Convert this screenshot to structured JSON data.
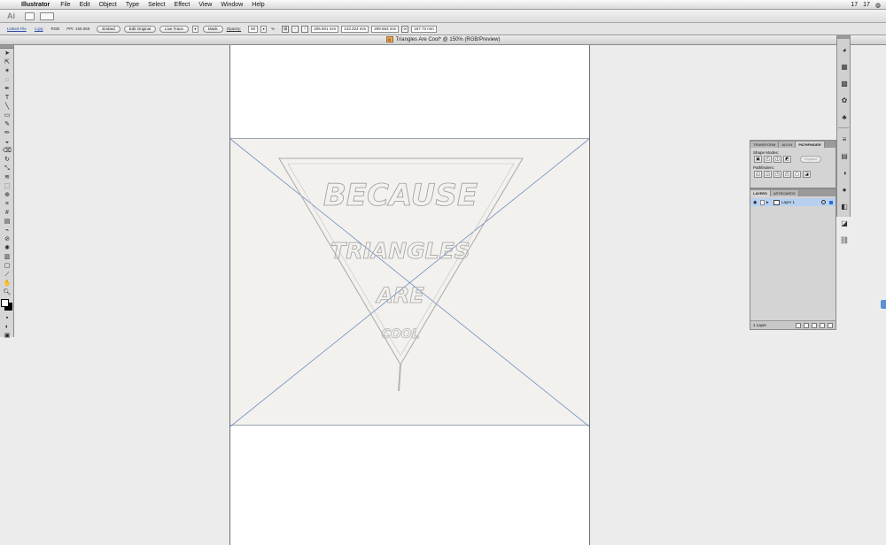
{
  "menubar": {
    "app": "Illustrator",
    "items": [
      "File",
      "Edit",
      "Object",
      "Type",
      "Select",
      "Effect",
      "View",
      "Window",
      "Help"
    ],
    "status_a": "17",
    "status_b": "17"
  },
  "appbar": {
    "logo": "Ai"
  },
  "controlbar": {
    "linked_file": "Linked File",
    "file_name": "1.jpg",
    "color_mode": "RGB",
    "ppi": "PPI: 155.068",
    "embed": "Embed",
    "edit_original": "Edit Original",
    "live_trace": "Live Trace",
    "mask": "Mask",
    "opacity_label": "Opacity:",
    "opacity_value": "60",
    "pct": "%",
    "x_value": "205.601 mm",
    "y_value": "143.324 mm",
    "w_value": "209.663 mm",
    "h_value": "167.73 mm"
  },
  "document": {
    "title": "Triangles Are Cool* @ 150% (RGB/Preview)",
    "icon_label": "Ai"
  },
  "artwork": {
    "line1": "BECAUSE",
    "line2": "TRIANGLES",
    "line3": "ARE",
    "line4": "COOL"
  },
  "pathfinder_panel": {
    "tabs": [
      "TRANSFORM",
      "ALIGN",
      "PATHFINDER"
    ],
    "shape_modes_label": "Shape Modes:",
    "pathfinders_label": "Pathfinders:",
    "expand": "Expand"
  },
  "layers_panel": {
    "tabs": [
      "LAYERS",
      "ARTBOARDS"
    ],
    "layer_name": "Layer 1",
    "count": "1 Layer"
  },
  "colors": {
    "selection": "#5b7fc4",
    "layer_highlight": "#b7d0f0"
  }
}
